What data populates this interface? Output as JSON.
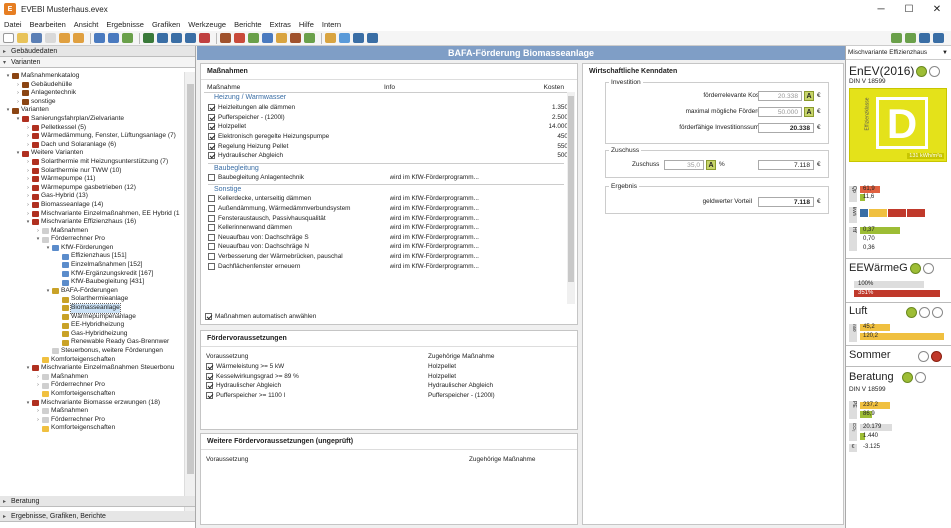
{
  "window": {
    "title": "EVEBI Musterhaus.evex",
    "app_icon_letter": "E",
    "min": "─",
    "max": "☐",
    "close": "✕"
  },
  "menu": [
    "Datei",
    "Bearbeiten",
    "Ansicht",
    "Ergebnisse",
    "Grafiken",
    "Werkzeuge",
    "Berichte",
    "Extras",
    "Hilfe",
    "Intern"
  ],
  "left": {
    "section_gebaeudedaten": "Gebäudedaten",
    "section_varianten": "Varianten",
    "section_beratung": "Beratung",
    "section_ergebnisse": "Ergebnisse, Grafiken, Berichte",
    "tree": [
      {
        "d": 0,
        "t": "▾",
        "c": "#8b4513",
        "l": "Maßnahmenkatalog"
      },
      {
        "d": 1,
        "t": "›",
        "c": "#8b4513",
        "l": "Gebäudehülle"
      },
      {
        "d": 1,
        "t": "›",
        "c": "#8b4513",
        "l": "Anlagentechnik"
      },
      {
        "d": 1,
        "t": "›",
        "c": "#8b4513",
        "l": "sonstige"
      },
      {
        "d": 0,
        "t": "▾",
        "c": "#8b4513",
        "l": "Varianten"
      },
      {
        "d": 1,
        "t": "▾",
        "c": "#b03020",
        "l": "Sanierungsfahrplan/Zielvariante"
      },
      {
        "d": 2,
        "t": "›",
        "c": "#b03020",
        "l": "Pelletkessel (5)"
      },
      {
        "d": 2,
        "t": "›",
        "c": "#b03020",
        "l": "Wärmedämmung, Fenster, Lüftungsanlage (7)"
      },
      {
        "d": 2,
        "t": "›",
        "c": "#b03020",
        "l": "Dach und Solaranlage (6)"
      },
      {
        "d": 1,
        "t": "▾",
        "c": "#b03020",
        "l": "Weitere Varianten"
      },
      {
        "d": 2,
        "t": "›",
        "c": "#b03020",
        "l": "Solarthermie mit Heizungsunterstützung (7)"
      },
      {
        "d": 2,
        "t": "›",
        "c": "#b03020",
        "l": "Solarthermie nur TWW (10)"
      },
      {
        "d": 2,
        "t": "›",
        "c": "#b03020",
        "l": "Wärmepumpe (11)"
      },
      {
        "d": 2,
        "t": "›",
        "c": "#b03020",
        "l": "Wärmepumpe gasbetrieben (12)"
      },
      {
        "d": 2,
        "t": "›",
        "c": "#b03020",
        "l": "Gas-Hybrid (13)"
      },
      {
        "d": 2,
        "t": "›",
        "c": "#b03020",
        "l": "Biomasseanlage (14)"
      },
      {
        "d": 2,
        "t": "›",
        "c": "#b03020",
        "l": "Mischvariante Einzelmaßnahmen, EE Hybrid (1"
      },
      {
        "d": 2,
        "t": "▾",
        "c": "#b03020",
        "l": "Mischvariante Effizienzhaus (16)"
      },
      {
        "d": 3,
        "t": "›",
        "c": "#cfcfcf",
        "l": "Maßnahmen"
      },
      {
        "d": 3,
        "t": "▾",
        "c": "#cfcfcf",
        "l": "Förderrechner Pro"
      },
      {
        "d": 4,
        "t": "▾",
        "c": "#5b8ccb",
        "l": "KfW-Förderungen"
      },
      {
        "d": 5,
        "t": "",
        "c": "#5b8ccb",
        "l": "Effizienzhaus [151]"
      },
      {
        "d": 5,
        "t": "",
        "c": "#5b8ccb",
        "l": "Einzelmaßnahmen [152]"
      },
      {
        "d": 5,
        "t": "",
        "c": "#5b8ccb",
        "l": "KfW-Ergänzungskredit [167]"
      },
      {
        "d": 5,
        "t": "",
        "c": "#5b8ccb",
        "l": "KfW-Baubegleitung [431]"
      },
      {
        "d": 4,
        "t": "▾",
        "c": "#c9a227",
        "l": "BAFA-Förderungen"
      },
      {
        "d": 5,
        "t": "",
        "c": "#c9a227",
        "l": "Solarthermieanlage"
      },
      {
        "d": 5,
        "t": "",
        "c": "#c9a227",
        "l": "Biomasseanlage",
        "sel": true
      },
      {
        "d": 5,
        "t": "",
        "c": "#c9a227",
        "l": "Wärmepumpenanlage"
      },
      {
        "d": 5,
        "t": "",
        "c": "#c9a227",
        "l": "EE-Hybridheizung"
      },
      {
        "d": 5,
        "t": "",
        "c": "#c9a227",
        "l": "Gas-Hybridheizung"
      },
      {
        "d": 5,
        "t": "",
        "c": "#c9a227",
        "l": "Renewable Ready Gas-Brennwer"
      },
      {
        "d": 4,
        "t": "",
        "c": "#cfcfcf",
        "l": "Steuerbonus, weitere Förderungen"
      },
      {
        "d": 3,
        "t": "",
        "c": "#f0c040",
        "l": "Komforteigenschaften"
      },
      {
        "d": 2,
        "t": "▾",
        "c": "#b03020",
        "l": "Mischvariante Einzelmaßnahmen Steuerbonu"
      },
      {
        "d": 3,
        "t": "›",
        "c": "#cfcfcf",
        "l": "Maßnahmen"
      },
      {
        "d": 3,
        "t": "›",
        "c": "#cfcfcf",
        "l": "Förderrechner Pro"
      },
      {
        "d": 3,
        "t": "",
        "c": "#f0c040",
        "l": "Komforteigenschaften"
      },
      {
        "d": 2,
        "t": "▾",
        "c": "#b03020",
        "l": "Mischvariante Biomasse erzwungen (18)"
      },
      {
        "d": 3,
        "t": "›",
        "c": "#cfcfcf",
        "l": "Maßnahmen"
      },
      {
        "d": 3,
        "t": "›",
        "c": "#cfcfcf",
        "l": "Förderrechner Pro"
      },
      {
        "d": 3,
        "t": "",
        "c": "#f0c040",
        "l": "Komforteigenschaften"
      }
    ]
  },
  "main": {
    "header": "BAFA-Förderung Biomasseanlage",
    "massnahmen": {
      "title": "Maßnahmen",
      "col_massnahme": "Maßnahme",
      "col_info": "Info",
      "col_kosten": "Kosten",
      "group1": "Heizung / Warmwasser",
      "group1_rows": [
        {
          "l": "Heizleitungen alle dämmen",
          "k": "1.350"
        },
        {
          "l": "Pufferspeicher - (1200l)",
          "k": "2.500"
        },
        {
          "l": "Holzpellet",
          "k": "14.000"
        },
        {
          "l": "Elektronisch geregelte Heizungspumpe",
          "k": "450"
        },
        {
          "l": "Regelung Heizung Pellet",
          "k": "550"
        },
        {
          "l": "Hydraulischer Abgleich",
          "k": "500"
        }
      ],
      "group2": "Baubegleitung",
      "group2_rows": [
        {
          "l": "Baubegleitung Anlagentechnik",
          "i": "wird im KfW-Förderprogramm..."
        }
      ],
      "group3": "Sonstige",
      "group3_rows": [
        {
          "l": "Kellerdecke, unterseitig dämmen",
          "i": "wird im KfW-Förderprogramm..."
        },
        {
          "l": "Außendämmung, Wärmedämmverbundsystem",
          "i": "wird im KfW-Förderprogramm..."
        },
        {
          "l": "Fensteraustausch, Passivhausqualität",
          "i": "wird im KfW-Förderprogramm..."
        },
        {
          "l": "Kellerinnenwand dämmen",
          "i": "wird im KfW-Förderprogramm..."
        },
        {
          "l": "Neuaufbau von: Dachschräge S",
          "i": "wird im KfW-Förderprogramm..."
        },
        {
          "l": "Neuaufbau von: Dachschräge N",
          "i": "wird im KfW-Förderprogramm..."
        },
        {
          "l": "Verbesserung der Wärmebrücken, pauschal",
          "i": "wird im KfW-Förderprogramm..."
        },
        {
          "l": "Dachflächenfenster erneuern",
          "i": "wird im KfW-Förderprogramm..."
        }
      ],
      "auto": "Maßnahmen automatisch anwählen"
    },
    "foerder": {
      "title": "Fördervoraussetzungen",
      "col_vor": "Voraussetzung",
      "col_mass": "Zugehörige Maßnahme",
      "rows": [
        {
          "v": "Wärmeleistung >= 5 kW",
          "m": "Holzpellet"
        },
        {
          "v": "Kesselwirkungsgrad >= 89 %",
          "m": "Holzpellet"
        },
        {
          "v": "Hydraulischer Abgleich",
          "m": "Hydraulischer Abgleich"
        },
        {
          "v": "Pufferspeicher >= 1100 l",
          "m": "Pufferspeicher - (1200l)"
        }
      ]
    },
    "weitere": {
      "title": "Weitere Fördervoraussetzungen (ungeprüft)",
      "col_vor": "Voraussetzung",
      "col_mass": "Zugehörige Maßnahme"
    },
    "wirtschaft": {
      "title": "Wirtschaftliche Kenndaten",
      "investition": "Investition",
      "foerderrelevant": "förderrelevante Kosten",
      "foerderrelevant_val": "20.338",
      "max_foerderung": "maximal mögliche Förderung",
      "max_foerderung_val": "50.000",
      "foerderfaehig": "förderfähige Investitionssumme",
      "foerderfaehig_val": "20.338",
      "zuschuss_group": "Zuschuss",
      "zuschuss": "Zuschuss",
      "zuschuss_pct": "35,0",
      "pct": "%",
      "zuschuss_val": "7.118",
      "ergebnis": "Ergebnis",
      "vorteil": "geldwerter Vorteil",
      "vorteil_val": "7.118",
      "euro": "€",
      "a": "A"
    }
  },
  "right": {
    "dropdown": "Mischvariante Effizienzhaus",
    "enev": "EnEV(2016)",
    "din": "DIN V 18599",
    "grade": "D",
    "grade_sub": "131 kWh/m²a",
    "side_label": "Effizienzklasse",
    "qp_lbl": "Qp",
    "qp1": "61,9",
    "qp2": "11,6",
    "kw_lbl": "kWh",
    "ht_lbl": "Ht'",
    "ht1": "0,37",
    "ht2": "0,70",
    "ht3": "0,36",
    "ewg": "EEWärmeG",
    "ewg1": "100%",
    "ewg2": "351%",
    "luft": "Luft",
    "luft_lbl": "n50",
    "luft1": "45,2",
    "luft2": "120,2",
    "sommer": "Sommer",
    "beratung": "Beratung",
    "din2": "DIN V 18599",
    "pe_lbl": "PE",
    "pe1": "237,2",
    "pe2": "86,9",
    "co2_lbl": "CO₂",
    "co21": "20.179",
    "co22": "1.440",
    "eur_lbl": "€",
    "eur": "-3.125"
  }
}
